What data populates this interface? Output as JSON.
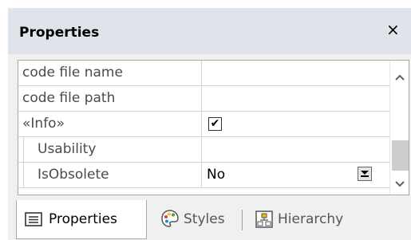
{
  "panel": {
    "title": "Properties",
    "close_label": "×"
  },
  "rows": [
    {
      "name": "code file name",
      "value": ""
    },
    {
      "name": "code file path",
      "value": ""
    },
    {
      "name": "«Info»",
      "checked": true
    },
    {
      "name": "Usability",
      "value": ""
    },
    {
      "name": "IsObsolete",
      "value": "No"
    }
  ],
  "tabs": [
    {
      "label": "Properties",
      "icon": "properties-list-icon",
      "active": true
    },
    {
      "label": "Styles",
      "icon": "palette-icon",
      "active": false
    },
    {
      "label": "Hierarchy",
      "icon": "hierarchy-icon",
      "active": false
    }
  ],
  "colors": {
    "title_bar": "#dfe3ea",
    "panel_bg": "#f0f0f0",
    "grid_line": "#d4d4d4"
  }
}
